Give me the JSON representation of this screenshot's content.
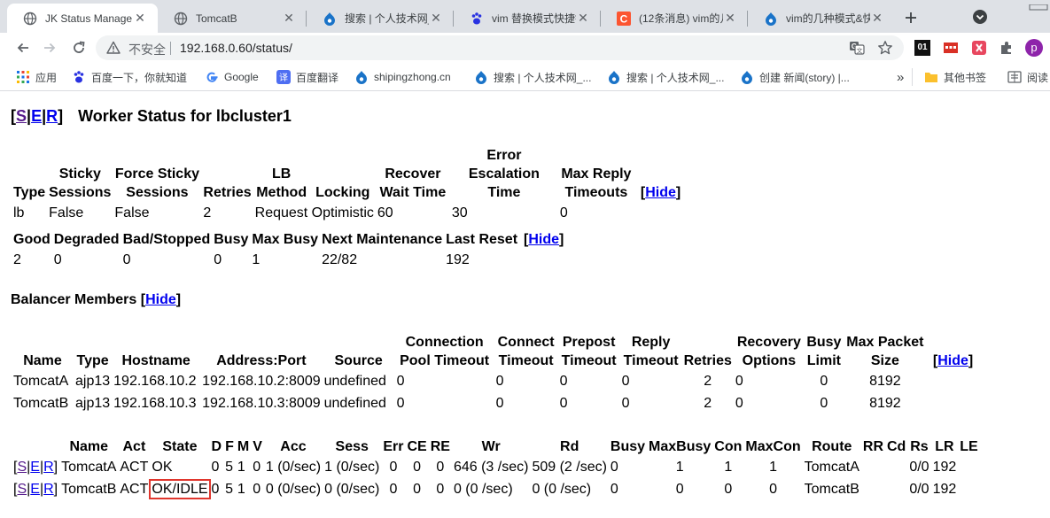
{
  "browser": {
    "tabs": [
      {
        "title": "JK Status Manage",
        "active": true,
        "favicon": "globe-icon"
      },
      {
        "title": "TomcatB",
        "active": false,
        "favicon": "globe-icon"
      },
      {
        "title": "搜索 | 个人技术网_",
        "active": false,
        "favicon": "drupal-icon"
      },
      {
        "title": "vim 替换模式快捷键",
        "active": false,
        "favicon": "baidu-paw-icon"
      },
      {
        "title": "(12条消息) vim的几",
        "active": false,
        "favicon": "csdn-icon"
      },
      {
        "title": "vim的几种模式&快",
        "active": false,
        "favicon": "drupal-icon"
      }
    ],
    "security_label": "不安全",
    "url": "192.168.0.60/status/",
    "avatar_letter": "p",
    "ext_badge": "01",
    "bookmarks": [
      {
        "label": "应用",
        "icon": "apps-grid-icon"
      },
      {
        "label": "百度一下，你就知道",
        "icon": "baidu-paw-icon"
      },
      {
        "label": "Google",
        "icon": "google-icon"
      },
      {
        "label": "百度翻译",
        "icon": "translate-icon"
      },
      {
        "label": "shipingzhong.cn",
        "icon": "drupal-icon"
      },
      {
        "label": "搜索 | 个人技术网_...",
        "icon": "drupal-icon"
      },
      {
        "label": "搜索 | 个人技术网_...",
        "icon": "drupal-icon"
      },
      {
        "label": "创建 新闻(story) |...",
        "icon": "drupal-icon"
      }
    ],
    "bookmarks_overflow": "»",
    "other_bookmarks": "其他书签",
    "reading_list": "阅读"
  },
  "page": {
    "actions": {
      "open": "[",
      "s": "S",
      "sep1": "|",
      "e": "E",
      "sep2": "|",
      "r": "R",
      "close": "]"
    },
    "title": "Worker Status for lbcluster1",
    "hide_link": "Hide",
    "lb_table": {
      "headers": [
        "Type",
        "Sticky Sessions",
        "Force Sticky Sessions",
        "Retries",
        "LB Method",
        "Locking",
        "Recover Wait Time",
        "Error Escalation Time",
        "Max Reply Timeouts"
      ],
      "row": [
        "lb",
        "False",
        "False",
        "2",
        "Request",
        "Optimistic",
        "60",
        "30",
        "0"
      ]
    },
    "status_table": {
      "headers": [
        "Good",
        "Degraded",
        "Bad/Stopped",
        "Busy",
        "Max Busy",
        "Next Maintenance",
        "Last Reset"
      ],
      "row": [
        "2",
        "0",
        "0",
        "0",
        "1",
        "22/82",
        "192"
      ]
    },
    "members_heading": "Balancer Members",
    "members_table": {
      "headers": [
        "Name",
        "Type",
        "Hostname",
        "Address:Port",
        "Source",
        "Connection Pool Timeout",
        "Connect Timeout",
        "Prepost Timeout",
        "Reply Timeout",
        "Retries",
        "Recovery Options",
        "Busy Limit",
        "Max Packet Size"
      ],
      "rows": [
        [
          "TomcatA",
          "ajp13",
          "192.168.10.2",
          "192.168.10.2:8009",
          "undefined",
          "0",
          "0",
          "0",
          "0",
          "2",
          "0",
          "0",
          "8192"
        ],
        [
          "TomcatB",
          "ajp13",
          "192.168.10.3",
          "192.168.10.3:8009",
          "undefined",
          "0",
          "0",
          "0",
          "0",
          "2",
          "0",
          "0",
          "8192"
        ]
      ]
    },
    "runtime_table": {
      "headers": [
        "",
        "Name",
        "Act",
        "State",
        "D",
        "F",
        "M",
        "V",
        "Acc",
        "Sess",
        "Err",
        "CE",
        "RE",
        "Wr",
        "Rd",
        "Busy",
        "MaxBusy",
        "Con",
        "MaxCon",
        "Route",
        "RR",
        "Cd",
        "Rs",
        "LR",
        "LE"
      ],
      "rows": [
        [
          "TomcatA",
          "ACT",
          "OK",
          "0",
          "5",
          "1",
          "0",
          "1 (0/sec)",
          "1 (0/sec)",
          "0",
          "0",
          "0",
          "646 (3 /sec)",
          "509 (2 /sec)",
          "0",
          "1",
          "1",
          "1",
          "TomcatA",
          "",
          "",
          "0/0",
          "192",
          ""
        ],
        [
          "TomcatB",
          "ACT",
          "OK/IDLE",
          "0",
          "5",
          "1",
          "0",
          "0 (0/sec)",
          "0 (0/sec)",
          "0",
          "0",
          "0",
          "0 (0 /sec)",
          "0 (0 /sec)",
          "0",
          "0",
          "0",
          "0",
          "TomcatB",
          "",
          "",
          "0/0",
          "192",
          ""
        ]
      ]
    }
  }
}
